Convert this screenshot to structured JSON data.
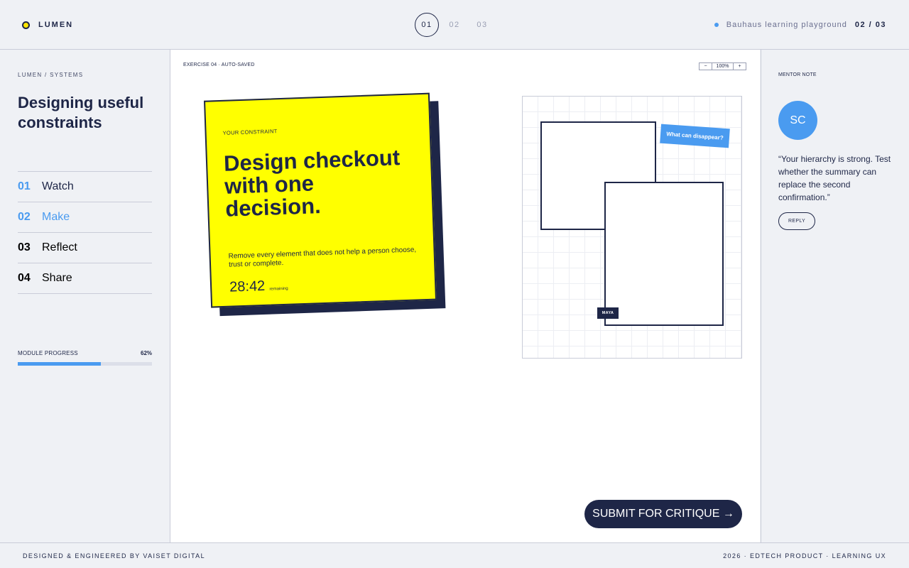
{
  "header": {
    "brand": "LUMEN",
    "steps": [
      "01",
      "02",
      "03"
    ],
    "active_step": "01",
    "tagline": "Bauhaus learning playground",
    "counter": "02 / 03"
  },
  "sidebar": {
    "breadcrumb": "LUMEN / SYSTEMS",
    "title": "Designing useful constraints",
    "items": [
      {
        "num": "01",
        "label": "Watch"
      },
      {
        "num": "02",
        "label": "Make"
      },
      {
        "num": "03",
        "label": "Reflect"
      },
      {
        "num": "04",
        "label": "Share"
      }
    ],
    "progress_label": "MODULE PROGRESS",
    "progress_text": "62%",
    "progress_value": 62
  },
  "canvas": {
    "exercise_label": "EXERCISE 04 · AUTO-SAVED",
    "zoom_minus": "−",
    "zoom_value": "100%",
    "zoom_plus": "+",
    "card": {
      "eyebrow": "YOUR CONSTRAINT",
      "headline": "Design checkout with one decision.",
      "body": "Remove every element that does not help a person choose, trust or complete.",
      "timer": "28:42",
      "timer_label": "remaining"
    },
    "sticky_note": "What can disappear?",
    "cursor_name": "MAYA",
    "submit_label": "SUBMIT FOR CRITIQUE →"
  },
  "mentor": {
    "label": "MENTOR NOTE",
    "initials": "SC",
    "quote": "“Your hierarchy is strong. Test whether the summary can replace the second confirmation.”",
    "reply_label": "REPLY"
  },
  "footer": {
    "left": "DESIGNED & ENGINEERED BY VAISET DIGITAL",
    "right": "2026 · EDTECH PRODUCT · LEARNING UX"
  },
  "colors": {
    "navy": "#1e2647",
    "accent_blue": "#4a9bf0",
    "yellow": "#ffff00",
    "background": "#eff1f5"
  }
}
